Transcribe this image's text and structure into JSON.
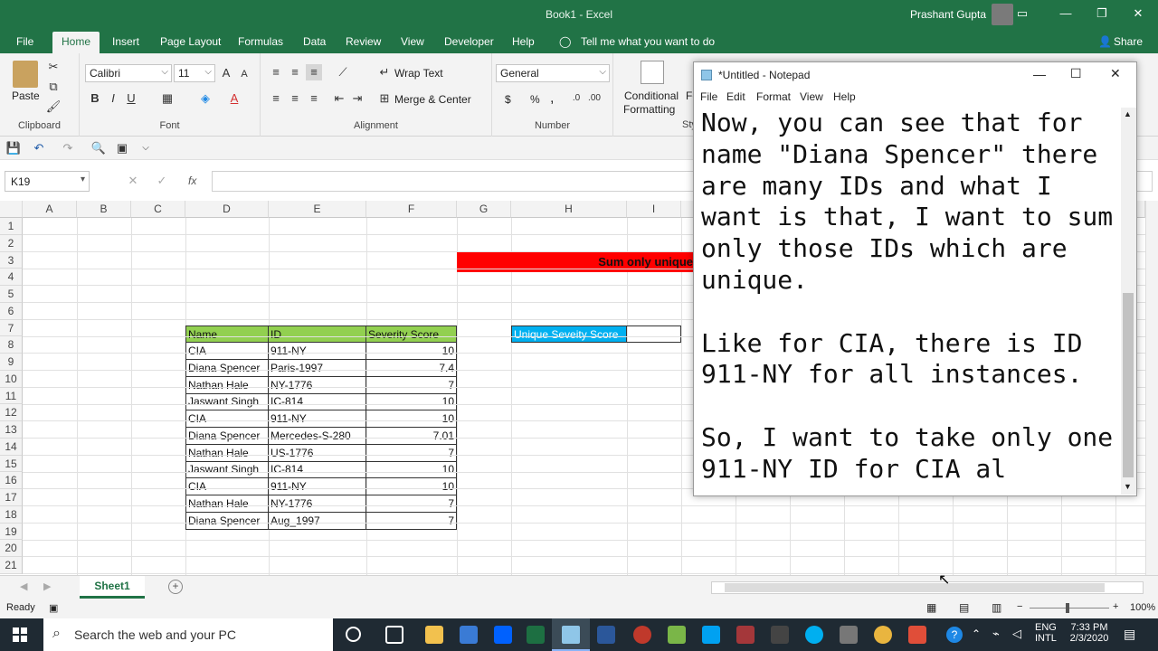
{
  "excel": {
    "title": "Book1 - Excel",
    "user": "Prashant Gupta",
    "tabs": [
      "File",
      "Home",
      "Insert",
      "Page Layout",
      "Formulas",
      "Data",
      "Review",
      "View",
      "Developer",
      "Help"
    ],
    "tell_me": "Tell me what you want to do",
    "share": "Share",
    "ribbon": {
      "paste": "Paste",
      "clipboard": "Clipboard",
      "font_name": "Calibri",
      "font_size": "11",
      "font": "Font",
      "wrap_text": "Wrap Text",
      "merge_center": "Merge & Center",
      "alignment": "Alignment",
      "number_format": "General",
      "number": "Number",
      "currency": "$",
      "percent": "%",
      "comma": ",",
      "cond_fmt_1": "Conditional",
      "cond_fmt_2": "Formatting",
      "styles_partial": "Sty",
      "fo_partial": "Fo",
      "bold": "B",
      "italic": "I",
      "underline": "U"
    },
    "name_box": "K19",
    "fx": "fx",
    "columns": [
      "A",
      "B",
      "C",
      "D",
      "E",
      "F",
      "G",
      "H",
      "I"
    ],
    "rows": [
      "1",
      "2",
      "3",
      "4",
      "5",
      "6",
      "7",
      "8",
      "9",
      "10",
      "11",
      "12",
      "13",
      "14",
      "15",
      "16",
      "17",
      "18",
      "19",
      "20",
      "21"
    ],
    "banner": "Sum only unique",
    "headers": [
      "Name",
      "ID",
      "Severity Score"
    ],
    "unique_label": "Unique Seveity Score",
    "data": [
      [
        "CIA",
        "911-NY",
        "10"
      ],
      [
        "Diana Spencer",
        "Paris-1997",
        "7.4"
      ],
      [
        "Nathan Hale",
        "NY-1776",
        "7"
      ],
      [
        "Jaswant Singh",
        "IC-814",
        "10"
      ],
      [
        "CIA",
        "911-NY",
        "10"
      ],
      [
        "Diana Spencer",
        "Mercedes-S-280",
        "7.01"
      ],
      [
        "Nathan Hale",
        "US-1776",
        "7"
      ],
      [
        "Jaswant Singh",
        "IC-814",
        "10"
      ],
      [
        "CIA",
        "911-NY",
        "10"
      ],
      [
        "Nathan Hale",
        "NY-1776",
        "7"
      ],
      [
        "Diana Spencer",
        "Aug_1997",
        "7"
      ]
    ],
    "sheet_tab": "Sheet1",
    "status": "Ready",
    "zoom": "100%"
  },
  "notepad": {
    "title": "*Untitled - Notepad",
    "menu": [
      "File",
      "Edit",
      "Format",
      "View",
      "Help"
    ],
    "lines": [
      "Now, you can see that for",
      "name \"Diana Spencer\" there",
      "are many IDs and what I",
      "want is that, I want to sum",
      "only those IDs which are",
      "unique.",
      "",
      "Like for CIA, there is ID",
      "911-NY for all instances.",
      "",
      "So, I want to take only one",
      "911-NY ID for CIA al"
    ]
  },
  "taskbar": {
    "search": "Search the web and your PC",
    "lang1": "ENG",
    "lang2": "INTL",
    "time": "7:33 PM",
    "date": "2/3/2020"
  }
}
